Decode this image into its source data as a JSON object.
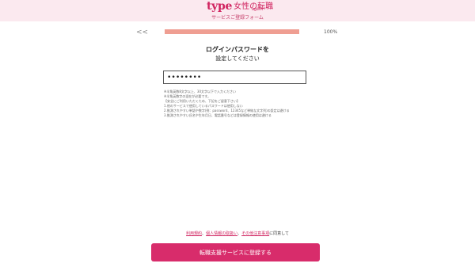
{
  "header": {
    "logo_type": "type",
    "logo_jp": "女性の転職",
    "logo_agent": "agent",
    "subtitle": "サービスご登録フォーム"
  },
  "progress": {
    "back_label": "<<",
    "percent_label": "100%",
    "value": 1.0
  },
  "form": {
    "title": "ログインパスワードを",
    "subtitle": "設定してください",
    "password_value": "••••••••",
    "notes": [
      "※半角英数8文字以上、30文字以下で入力ください",
      "※半角英数字の混在が必要です。",
      "【安全にご利用いただくため、下記をご留意下さい】",
      "1.他のサービスで使用しているパスワードは使用しない",
      "2.推測されやすい単語や数字(例：password、12345など単純な文字列)の設定は避ける",
      "3.推測されやすい氏名や生年月日、電話番号などは登録情報の使用は避ける"
    ]
  },
  "agreement": {
    "link1": "利用規約",
    "sep1": "、",
    "link2": "個人情報の取扱い",
    "sep2": "、",
    "link3": "その他注意事項",
    "suffix": "に同意して"
  },
  "submit_label": "転職支援サービスに登録する"
}
